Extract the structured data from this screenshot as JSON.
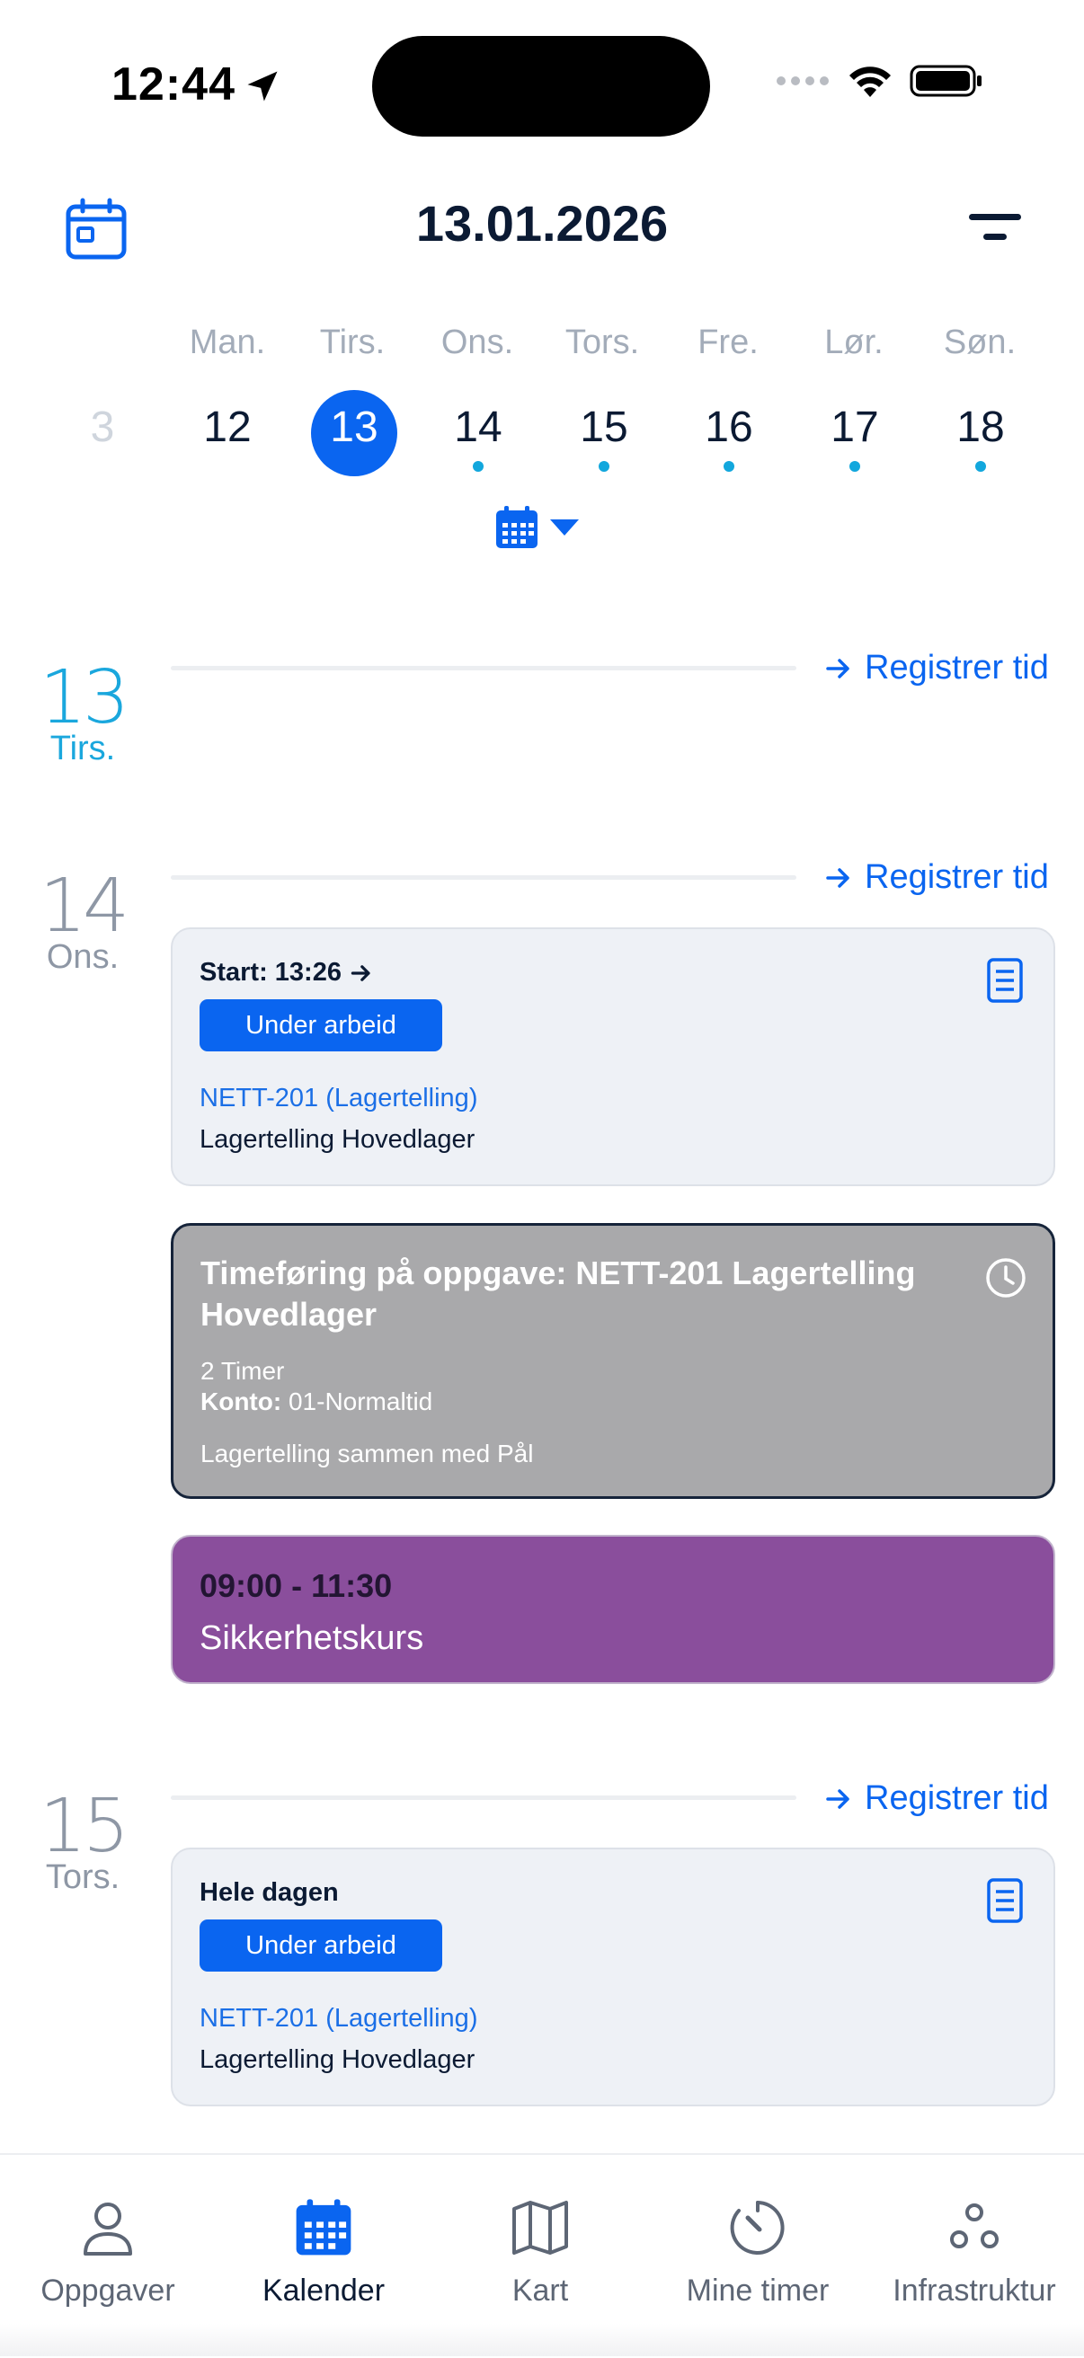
{
  "status_bar": {
    "time": "12:44",
    "icons": [
      "location-arrow-icon",
      "cellular-icon",
      "wifi-icon",
      "battery-icon"
    ]
  },
  "header": {
    "date": "13.01.2026",
    "left_icon": "calendar-icon",
    "right_icon": "filter-icon"
  },
  "week": {
    "day_names": [
      "Man.",
      "Tirs.",
      "Ons.",
      "Tors.",
      "Fre.",
      "Lør.",
      "Søn."
    ],
    "previous_fragment": "3",
    "dates": [
      "12",
      "13",
      "14",
      "15",
      "16",
      "17",
      "18"
    ],
    "selected": "13",
    "has_items": [
      "14",
      "15",
      "16",
      "17",
      "18"
    ],
    "toggle_icon": "calendar-grid-icon"
  },
  "register_label": "Registrer tid",
  "days": [
    {
      "num": "13",
      "name": "Tirs."
    },
    {
      "num": "14",
      "name": "Ons.",
      "task": {
        "start": "Start: 13:26",
        "status": "Under arbeid",
        "link": "NETT-201 (Lagertelling)",
        "description": "Lagertelling Hovedlager"
      },
      "timesheet": {
        "title": "Timeføring på oppgave: NETT-201 Lagertelling Hovedlager",
        "hours": "2 Timer",
        "account_label": "Konto:",
        "account": "01-Normaltid",
        "note": "Lagertelling sammen med Pål"
      },
      "event": {
        "time": "09:00 - 11:30",
        "title": "Sikkerhetskurs"
      }
    },
    {
      "num": "15",
      "name": "Tors.",
      "task": {
        "start": "Hele dagen",
        "status": "Under arbeid",
        "link": "NETT-201 (Lagertelling)",
        "description": "Lagertelling Hovedlager"
      }
    }
  ],
  "tabs": [
    {
      "label": "Oppgaver",
      "icon": "person-icon"
    },
    {
      "label": "Kalender",
      "icon": "calendar-icon",
      "active": true
    },
    {
      "label": "Kart",
      "icon": "map-icon"
    },
    {
      "label": "Mine timer",
      "icon": "timer-icon"
    },
    {
      "label": "Infrastruktur",
      "icon": "infrastructure-icon"
    }
  ],
  "colors": {
    "accent": "#0a65f0",
    "today": "#1aa7dd",
    "event": "#8a4e9c",
    "timesheet": "#a9a9ab"
  }
}
